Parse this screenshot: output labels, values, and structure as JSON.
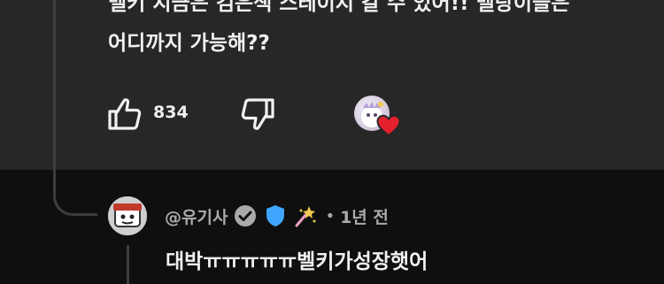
{
  "comment": {
    "text": "벨키 지금은 검은색 스테이지 갈 수 있어!! 벨탕이들은\n어디까지 가능해??",
    "like_count": "834",
    "icons": {
      "like": "thumb-up-icon",
      "dislike": "thumb-down-icon",
      "creator_heart": "creator-heart-icon"
    }
  },
  "reply": {
    "author": "@유기사",
    "badges": [
      "verified-check-icon",
      "blue-shield-badge-icon",
      "sparkle-wand-emoji-icon"
    ],
    "separator": "•",
    "time": "1년 전",
    "text": "대박ㅠㅠㅠㅠㅠ벨키가성장햇어"
  },
  "colors": {
    "background": "#0f0f0f",
    "highlight_background": "#272727",
    "text_primary": "#f1f1f1",
    "text_secondary": "#aaaaaa",
    "heart_red": "#e5202e",
    "badge_blue": "#3ea6ff"
  }
}
